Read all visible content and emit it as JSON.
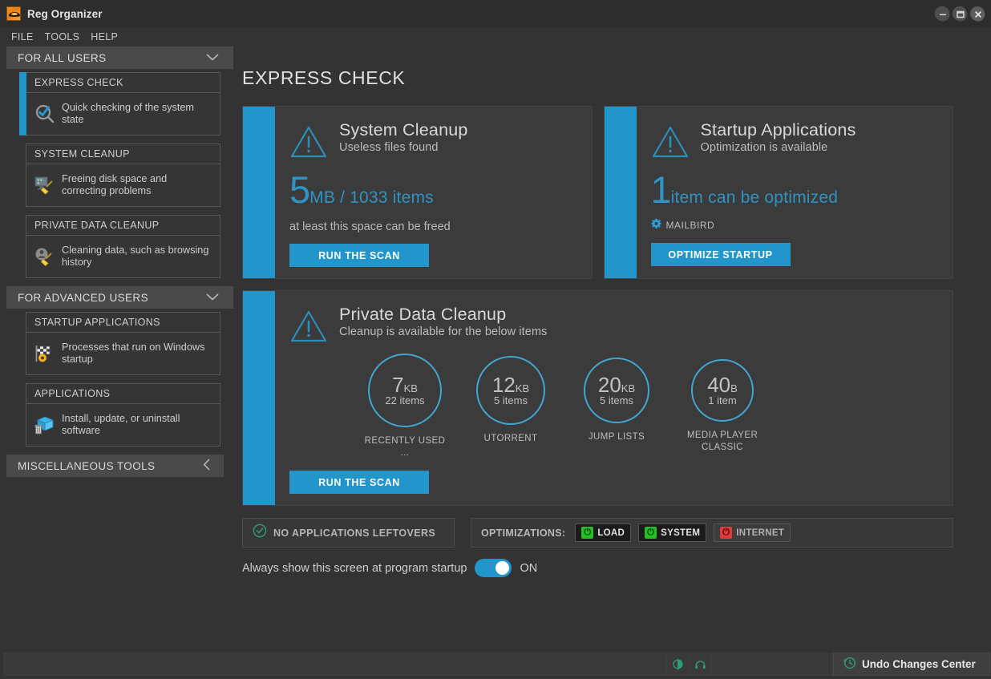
{
  "window": {
    "title": "Reg Organizer",
    "app_icon": "reg-organizer-logo",
    "buttons": {
      "minimize": "–",
      "maximize": "▭",
      "close": "✕"
    }
  },
  "menubar": {
    "items": [
      "FILE",
      "TOOLS",
      "HELP"
    ]
  },
  "theme": {
    "accent": "#2296ca",
    "page_bg": "#333333",
    "card_bg": "#3b3b3b",
    "circle_stroke": "#41a6d0",
    "green": "#25c025",
    "red": "#e03a3a"
  },
  "sidebar": {
    "groups": [
      {
        "label": "FOR ALL USERS",
        "chevron": "chevron-down-icon",
        "expanded": true,
        "items": [
          {
            "title": "EXPRESS CHECK",
            "desc": "Quick checking of the system state",
            "icon": "magnifier-check-icon",
            "active": true
          },
          {
            "title": "SYSTEM CLEANUP",
            "desc": "Freeing disk space and correcting problems",
            "icon": "monitor-broom-icon",
            "active": false
          },
          {
            "title": "PRIVATE DATA CLEANUP",
            "desc": "Cleaning data, such as browsing history",
            "icon": "user-broom-icon",
            "active": false
          }
        ]
      },
      {
        "label": "FOR ADVANCED USERS",
        "chevron": "chevron-down-icon",
        "expanded": true,
        "items": [
          {
            "title": "STARTUP APPLICATIONS",
            "desc": "Processes that run on Windows startup",
            "icon": "flag-gear-icon",
            "active": false
          },
          {
            "title": "APPLICATIONS",
            "desc": "Install, update, or uninstall software",
            "icon": "box-trash-icon",
            "active": false
          }
        ]
      }
    ],
    "misc": {
      "label": "MISCELLANEOUS TOOLS",
      "chevron": "chevron-left-icon",
      "expanded": false
    }
  },
  "main": {
    "page_title": "EXPRESS CHECK",
    "cards": [
      {
        "icon": "warning-triangle-icon",
        "title": "System Cleanup",
        "subtitle": "Useless files found",
        "big_number": "5",
        "big_unit": "MB / 1033 items",
        "note": "at least this space can be freed",
        "button": "RUN THE SCAN"
      },
      {
        "icon": "warning-triangle-icon",
        "title": "Startup Applications",
        "subtitle": "Optimization is available",
        "big_number": "1",
        "big_unit": "item can be optimized",
        "sub_item": {
          "icon": "gear-icon",
          "label": "MAILBIRD"
        },
        "button": "OPTIMIZE STARTUP"
      }
    ],
    "wide_card": {
      "icon": "warning-triangle-icon",
      "title": "Private Data Cleanup",
      "subtitle": "Cleanup is available for the below items",
      "button": "RUN THE SCAN",
      "circles": [
        {
          "num": "7",
          "unit": "KB",
          "items": "22 items",
          "label": "RECENTLY USED ...",
          "size": 92
        },
        {
          "num": "12",
          "unit": "KB",
          "items": "5 items",
          "label": "UTORRENT",
          "size": 86
        },
        {
          "num": "20",
          "unit": "KB",
          "items": "5 items",
          "label": "JUMP LISTS",
          "size": 82
        },
        {
          "num": "40",
          "unit": "B",
          "items": "1 item",
          "label": "MEDIA PLAYER CLASSIC",
          "size": 78
        }
      ]
    },
    "leftovers_panel": {
      "icon": "check-circle-icon",
      "label": "NO APPLICATIONS LEFTOVERS"
    },
    "optimizations_panel": {
      "label": "OPTIMIZATIONS:",
      "chips": [
        {
          "label": "LOAD",
          "state": "on",
          "icon": "power-icon"
        },
        {
          "label": "SYSTEM",
          "state": "on",
          "icon": "power-icon"
        },
        {
          "label": "INTERNET",
          "state": "off",
          "icon": "power-off-icon"
        }
      ]
    },
    "startup_toggle": {
      "text": "Always show this screen at program startup",
      "state": "ON",
      "on": true
    }
  },
  "statusbar": {
    "icons": [
      "contrast-icon",
      "headphones-icon"
    ],
    "undo": {
      "icon": "undo-circle-icon",
      "label": "Undo Changes Center"
    }
  }
}
